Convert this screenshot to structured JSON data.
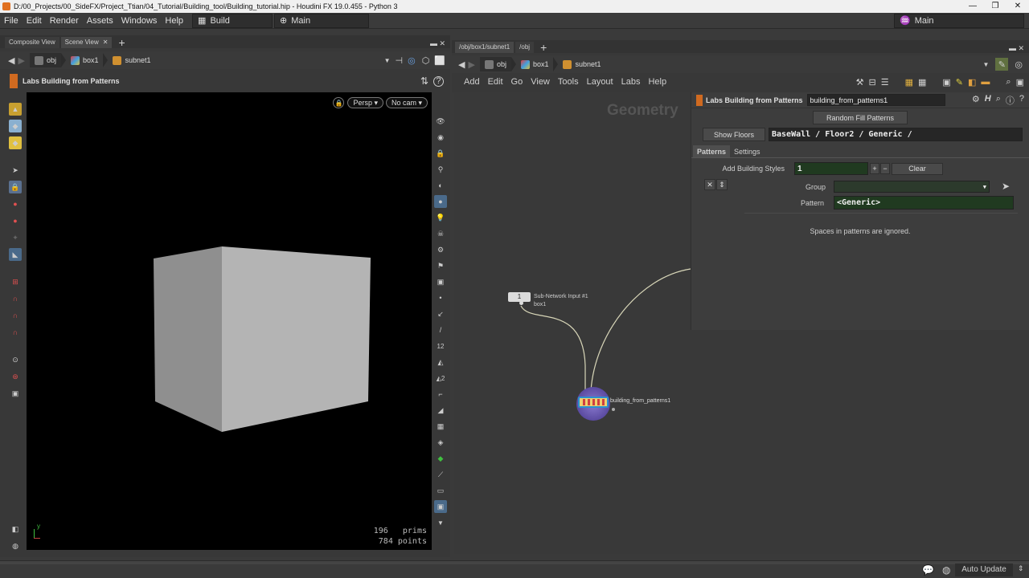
{
  "window": {
    "title": "D:/00_Projects/00_SideFX/Project_Ttian/04_Tutorial/Building_tool/Building_tutorial.hip - Houdini FX 19.0.455 - Python 3"
  },
  "menubar": {
    "items": [
      "File",
      "Edit",
      "Render",
      "Assets",
      "Windows",
      "Help"
    ],
    "desktop": "Build",
    "context": "Main",
    "desktop_right": "Main"
  },
  "left_panel": {
    "tabs": [
      "Composite View",
      "Scene View"
    ],
    "path": [
      "obj",
      "box1",
      "subnet1"
    ],
    "node_title": "Labs Building from Patterns",
    "viewport": {
      "persp": "Persp",
      "cam": "No cam",
      "stats": {
        "prims_count": "196",
        "prims_label": "prims",
        "points_count": "784",
        "points_label": "points"
      },
      "axis_label": "y"
    }
  },
  "right_panel": {
    "tabs": [
      "/obj/box1/subnet1",
      "/obj"
    ],
    "path": [
      "obj",
      "box1",
      "subnet1"
    ],
    "menu": [
      "Add",
      "Edit",
      "Go",
      "View",
      "Tools",
      "Layout",
      "Labs",
      "Help"
    ],
    "network_label": "Geometry",
    "nodes": {
      "input_number": "1",
      "input_name": "Sub-Network Input #1",
      "input_sub": "box1",
      "main_node": "building_from_patterns1"
    }
  },
  "parms": {
    "node_type": "Labs Building from Patterns",
    "node_name": "building_from_patterns1",
    "random_fill": "Random Fill Patterns",
    "show_floors": "Show Floors",
    "floors_value": "BaseWall / Floor2 / Generic /",
    "tabs": [
      "Patterns",
      "Settings"
    ],
    "add_styles_label": "Add Building Styles",
    "add_styles_value": "1",
    "plus": "+",
    "minus": "−",
    "clear": "Clear",
    "group_label": "Group",
    "group_value": "",
    "pattern_label": "Pattern",
    "pattern_value": "<Generic>",
    "note": "Spaces in patterns are ignored."
  },
  "statusbar": {
    "auto_update": "Auto Update"
  },
  "colors": {
    "node_purple": "#6a5aa8",
    "wire": "#d8d6b8",
    "pattern_green": "#203a20"
  }
}
